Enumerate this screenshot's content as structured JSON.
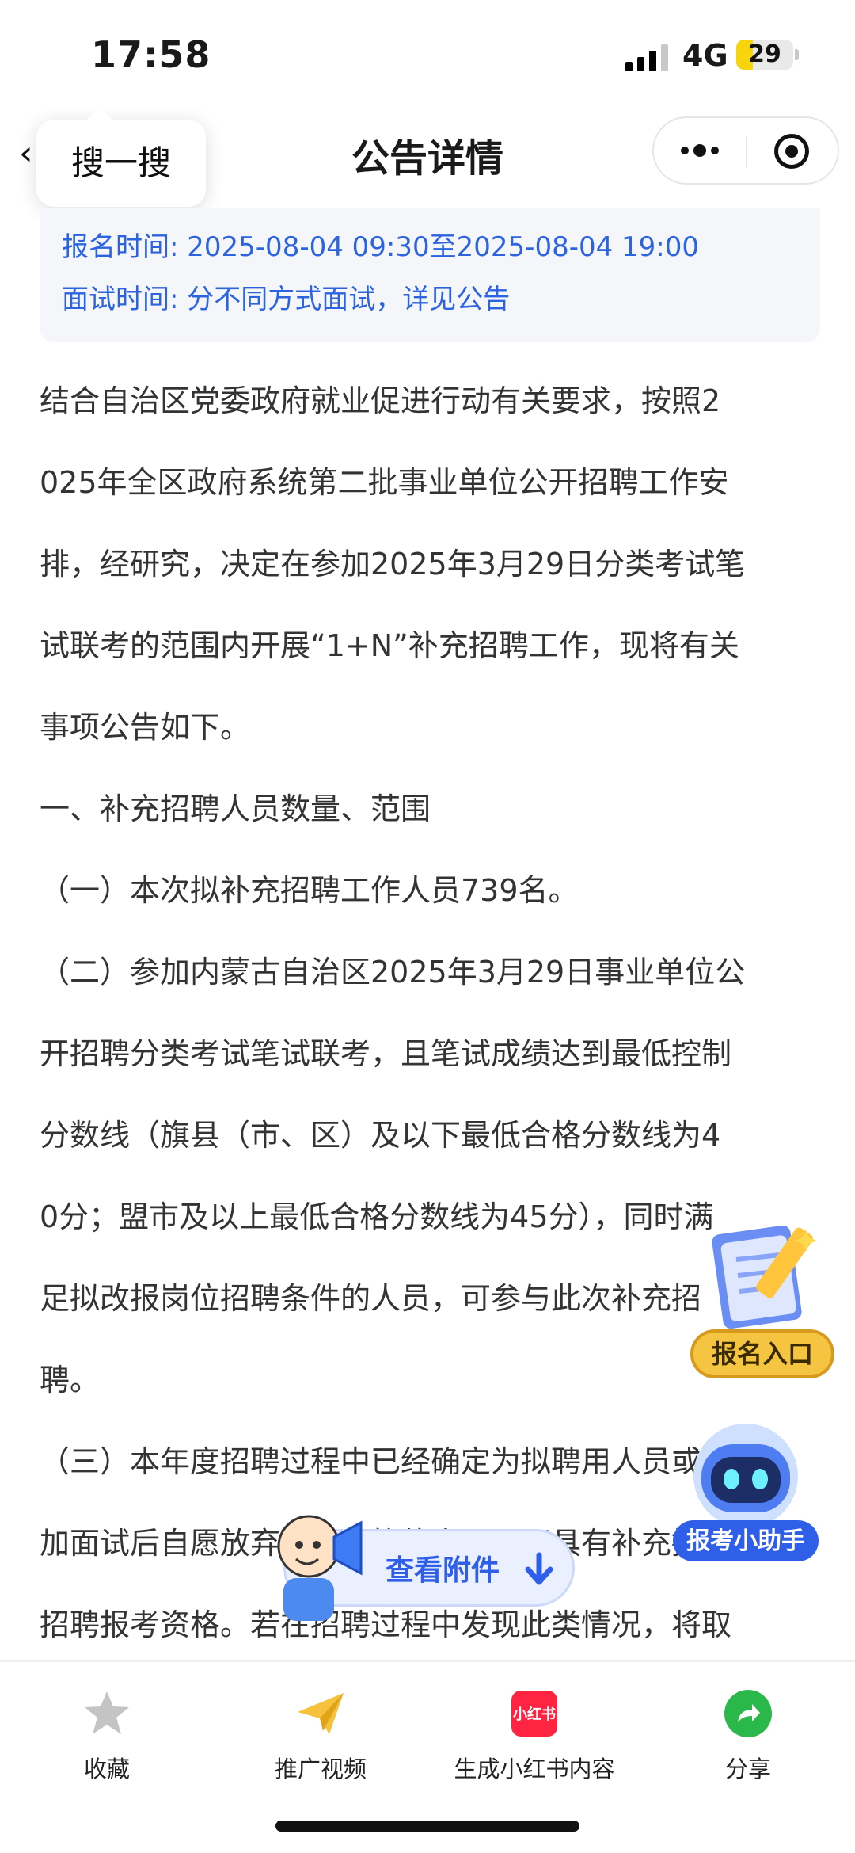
{
  "status_bar": {
    "time": "17:58",
    "network": "4G",
    "battery": "29",
    "battery_level_percent": 29
  },
  "nav": {
    "title": "公告详情",
    "tooltip": "搜一搜"
  },
  "info": {
    "signup_time": "报名时间: 2025-08-04 09:30至2025-08-04 19:00",
    "interview_time": "面试时间: 分不同方式面试，详见公告"
  },
  "article": {
    "lines": [
      "结合自治区党委政府就业促进行动有关要求，按照2",
      "025年全区政府系统第二批事业单位公开招聘工作安",
      "排，经研究，决定在参加2025年3月29日分类考试笔",
      "试联考的范围内开展“1+N”补充招聘工作，现将有关",
      "事项公告如下。",
      "一、补充招聘人员数量、范围",
      "（一）本次拟补充招聘工作人员739名。",
      "（二）参加内蒙古自治区2025年3月29日事业单位公",
      "开招聘分类考试笔试联考，且笔试成绩达到最低控制",
      "分数线（旗县（市、区）及以下最低合格分数线为4",
      "0分；盟市及以上最低合格分数线为45分），同时满",
      "足拟改报岗位招聘条件的人员，可参与此次补充招",
      "聘。",
      "（三）本年度招聘过程中已经确定为拟聘用人员或参",
      "加面试后自愿放弃聘用资格的人员，不具有补充招聘",
      "招聘报考资格。若在招聘过程中发现此类情况，将取"
    ]
  },
  "floats": {
    "signup_entry": "报名入口",
    "assistant": "报考小助手",
    "view_attachment": "查看附件"
  },
  "bottom_bar": {
    "favorite": "收藏",
    "promo_video": "推广视频",
    "xhs_badge": "小红书",
    "xhs_generate": "生成小红书内容",
    "share": "分享"
  },
  "colors": {
    "accent_blue": "#2b63e0",
    "xhs_red": "#ff2442",
    "share_green": "#2bb84a",
    "battery_yellow": "#f7d40b"
  }
}
